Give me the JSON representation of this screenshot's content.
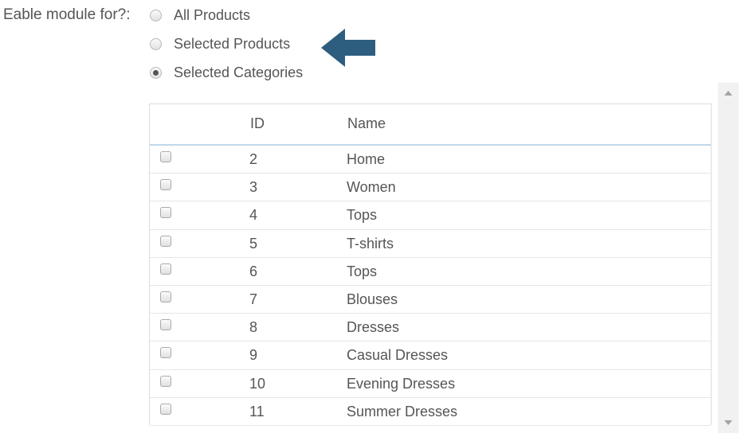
{
  "form": {
    "label": "Eable module for?:",
    "options": [
      {
        "label": "All Products",
        "checked": false
      },
      {
        "label": "Selected Products",
        "checked": false
      },
      {
        "label": "Selected Categories",
        "checked": true
      }
    ]
  },
  "annotation": {
    "arrow_color": "#2d5e80",
    "icon": "arrow-left-icon"
  },
  "table": {
    "headers": {
      "id": "ID",
      "name": "Name"
    },
    "rows": [
      {
        "id": "2",
        "name": "Home"
      },
      {
        "id": "3",
        "name": "Women"
      },
      {
        "id": "4",
        "name": "Tops"
      },
      {
        "id": "5",
        "name": "T-shirts"
      },
      {
        "id": "6",
        "name": "Tops"
      },
      {
        "id": "7",
        "name": "Blouses"
      },
      {
        "id": "8",
        "name": "Dresses"
      },
      {
        "id": "9",
        "name": "Casual Dresses"
      },
      {
        "id": "10",
        "name": "Evening Dresses"
      },
      {
        "id": "11",
        "name": "Summer Dresses"
      }
    ]
  },
  "colors": {
    "text": "#555555",
    "header_underline": "#bfd8ea",
    "scrollbar_track": "#f1f1f1"
  }
}
